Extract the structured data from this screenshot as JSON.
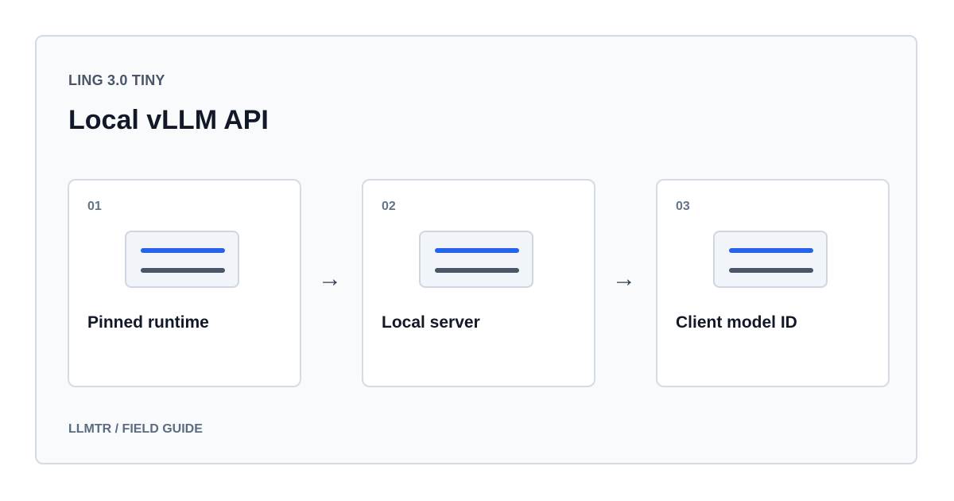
{
  "header": {
    "eyebrow": "LING 3.0 TINY",
    "title": "Local vLLM API"
  },
  "steps": [
    {
      "number": "01",
      "label": "Pinned runtime"
    },
    {
      "number": "02",
      "label": "Local server"
    },
    {
      "number": "03",
      "label": "Client model ID"
    }
  ],
  "arrows": [
    "→",
    "→"
  ],
  "footer": {
    "text": "LLMTR / FIELD GUIDE"
  },
  "colors": {
    "accent": "#2563eb",
    "secondary_line": "#4a5568",
    "border": "#d4dbe3",
    "panel_background": "#f8fafc"
  }
}
